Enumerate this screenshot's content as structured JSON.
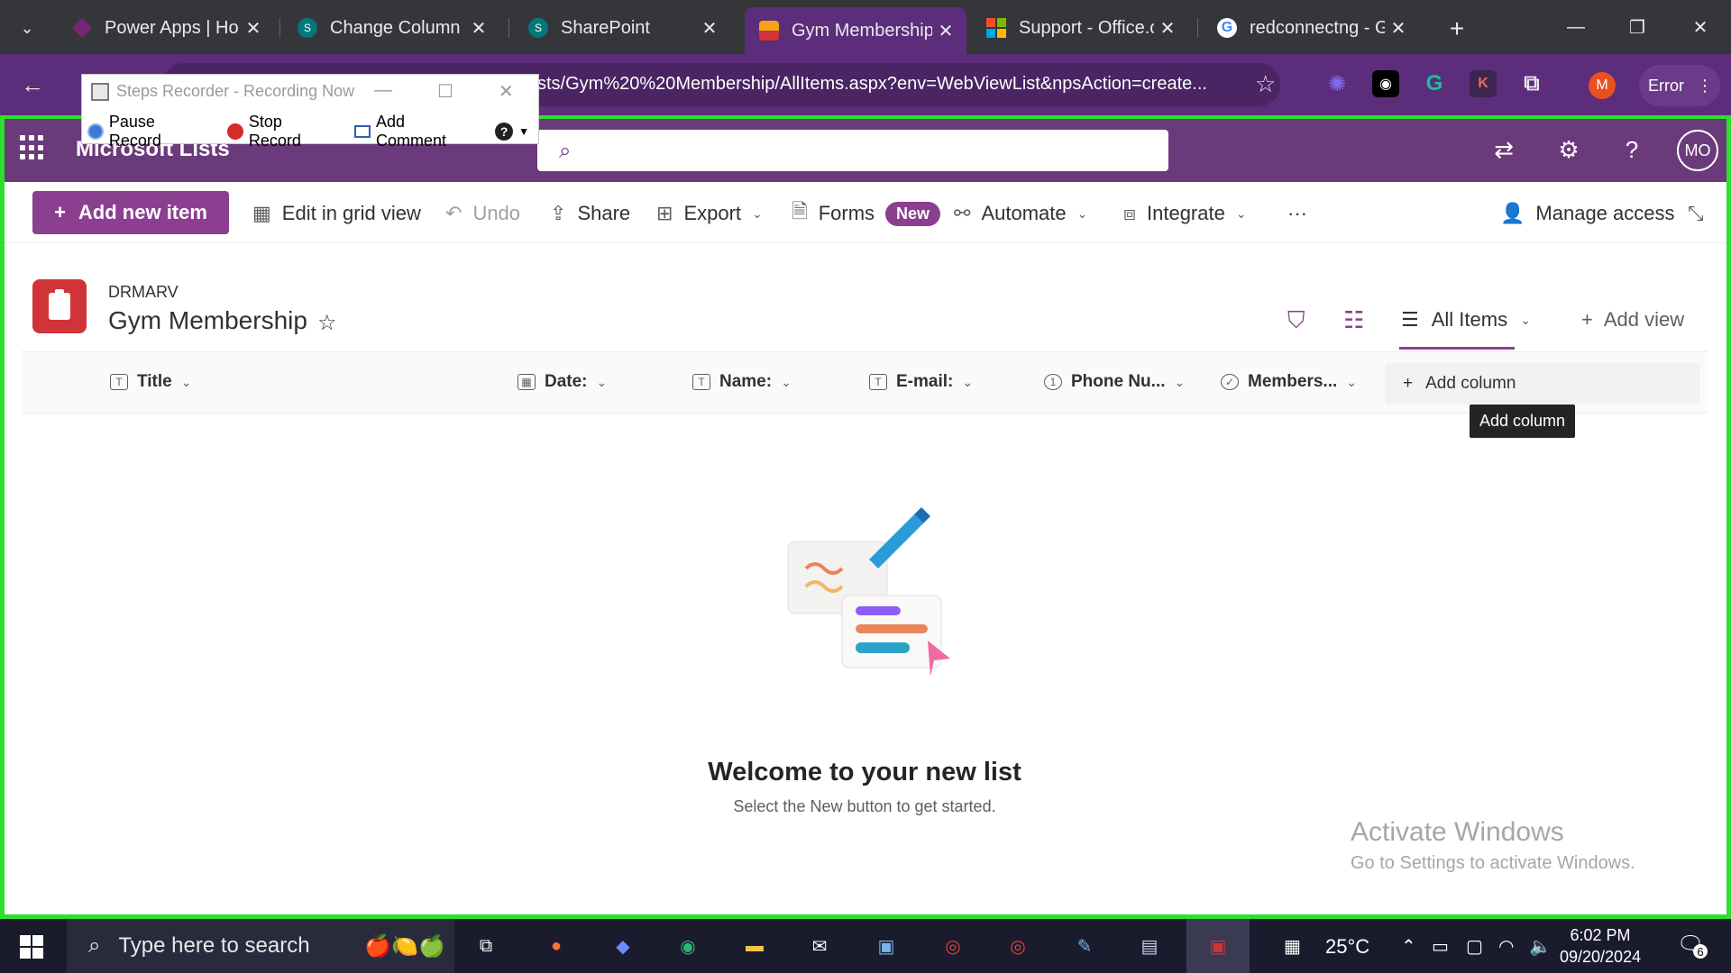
{
  "browser": {
    "tabs": [
      {
        "label": "Power Apps | Hom",
        "favicon": "power-apps-icon",
        "color": "#742774"
      },
      {
        "label": "Change Column",
        "favicon": "sharepoint-icon",
        "color": "#03787c"
      },
      {
        "label": "SharePoint",
        "favicon": "sharepoint-icon",
        "color": "#03787c"
      },
      {
        "label": "Gym Membership",
        "favicon": "lists-icon",
        "color": "#d13438",
        "active": true
      },
      {
        "label": "Support - Office.co",
        "favicon": "microsoft-icon",
        "color": "#f25022"
      },
      {
        "label": "redconnectng - Go",
        "favicon": "google-icon",
        "color": "#4285f4"
      }
    ],
    "url": "sts/Gym%20%20Membership/AllItems.aspx?env=WebViewList&npsAction=create...",
    "profile_initial": "M",
    "error_label": "Error",
    "accent": "#5c2d7a"
  },
  "steps_recorder": {
    "title": "Steps Recorder - Recording Now",
    "pause": "Pause Record",
    "stop": "Stop Record",
    "comment": "Add Comment"
  },
  "suite": {
    "app_title": "Microsoft Lists",
    "avatar": "MO",
    "color": "#6b3a7a"
  },
  "commands": {
    "add_new_item": "Add new item",
    "edit_grid": "Edit in grid view",
    "undo": "Undo",
    "share": "Share",
    "export": "Export",
    "forms": "Forms",
    "new_badge": "New",
    "automate": "Automate",
    "integrate": "Integrate",
    "more": "···",
    "manage_access": "Manage access"
  },
  "list": {
    "site": "DRMARV",
    "name": "Gym Membership",
    "view": "All Items",
    "add_view": "Add view"
  },
  "columns": [
    {
      "label": "Title",
      "icon": "text-column-icon"
    },
    {
      "label": "Date:",
      "icon": "calendar-column-icon"
    },
    {
      "label": "Name:",
      "icon": "text-column-icon"
    },
    {
      "label": "E-mail:",
      "icon": "text-column-icon"
    },
    {
      "label": "Phone Nu...",
      "icon": "number-column-icon"
    },
    {
      "label": "Members...",
      "icon": "choice-column-icon"
    }
  ],
  "add_column": "Add column",
  "tooltip": "Add column",
  "empty_state": {
    "title": "Welcome to your new list",
    "subtitle": "Select the New button to get started."
  },
  "watermark": {
    "line1": "Activate Windows",
    "line2": "Go to Settings to activate Windows."
  },
  "taskbar": {
    "search_placeholder": "Type here to search",
    "temperature": "25°C",
    "time": "6:02 PM",
    "date": "09/20/2024",
    "notifications": "6"
  }
}
